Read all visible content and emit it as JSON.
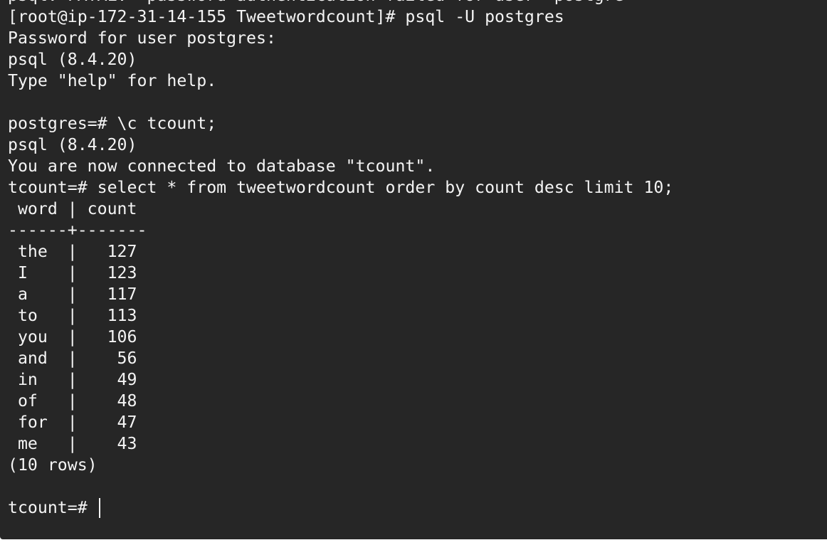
{
  "terminal": {
    "lines": [
      "psql: FATAL:  password authentication failed for user \"postgre\"",
      "[root@ip-172-31-14-155 Tweetwordcount]# psql -U postgres",
      "Password for user postgres:",
      "psql (8.4.20)",
      "Type \"help\" for help.",
      "",
      "postgres=# \\c tcount;",
      "psql (8.4.20)",
      "You are now connected to database \"tcount\".",
      "tcount=# select * from tweetwordcount order by count desc limit 10;",
      " word | count",
      "------+-------",
      " the  |   127",
      " I    |   123",
      " a    |   117",
      " to   |   113",
      " you  |   106",
      " and  |    56",
      " in   |    49",
      " of   |    48",
      " for  |    47",
      " me   |    43",
      "(10 rows)",
      ""
    ],
    "prompt": "tcount=# "
  }
}
